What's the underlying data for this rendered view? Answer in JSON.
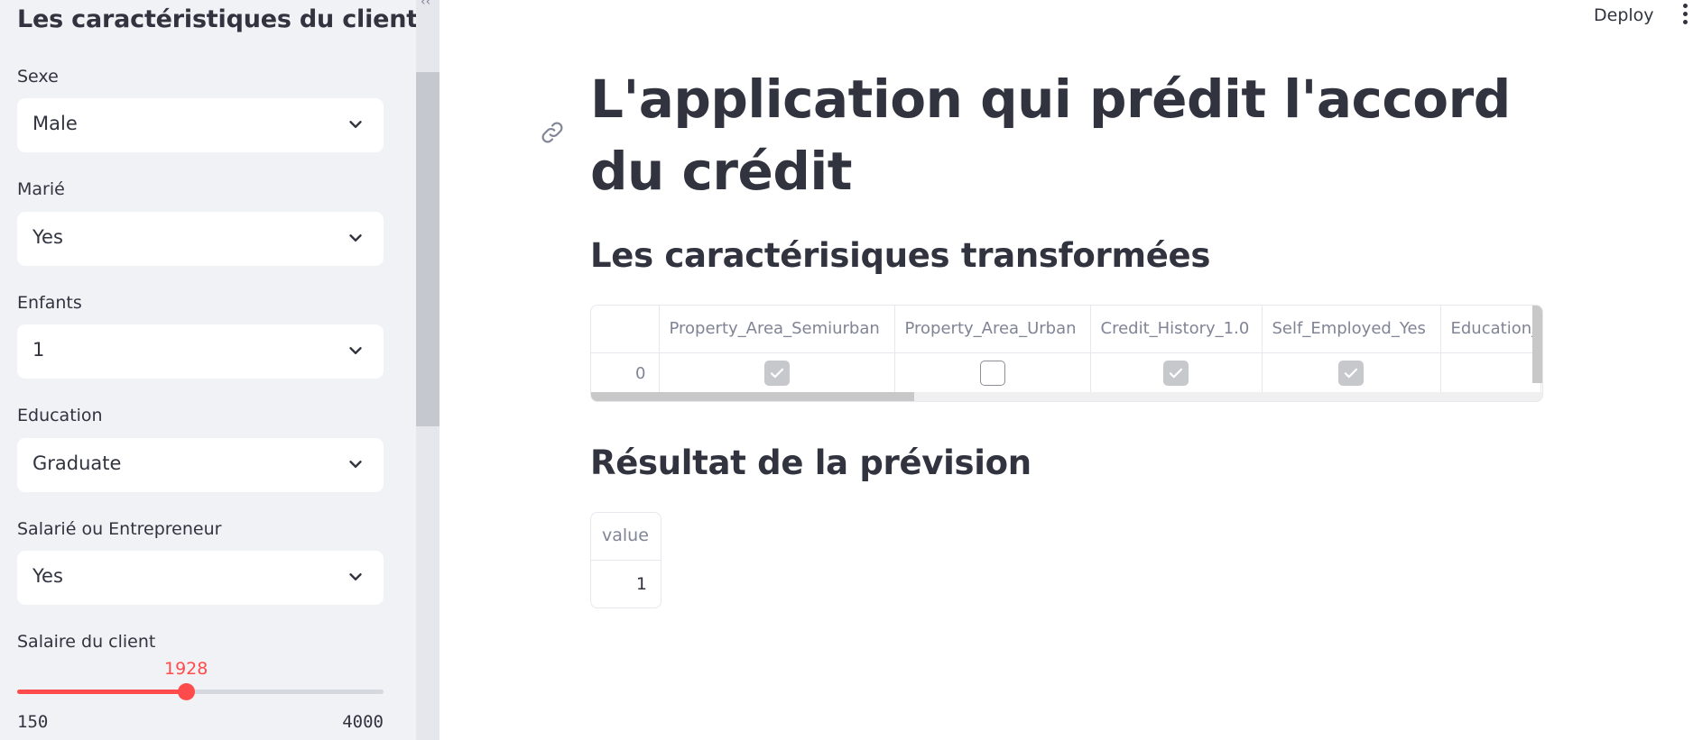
{
  "sidebar": {
    "title": "Les caractéristiques du client",
    "fields": [
      {
        "label": "Sexe",
        "value": "Male"
      },
      {
        "label": "Marié",
        "value": "Yes"
      },
      {
        "label": "Enfants",
        "value": "1"
      },
      {
        "label": "Education",
        "value": "Graduate"
      },
      {
        "label": "Salarié ou Entrepreneur",
        "value": "Yes"
      }
    ],
    "slider": {
      "label": "Salaire du client",
      "value": "1928",
      "min": "150",
      "max": "4000",
      "fraction": 0.4618
    }
  },
  "header": {
    "deploy_label": "Deploy"
  },
  "main": {
    "title": "L'application qui prédit l'accord du crédit",
    "transformed_heading": "Les caractérisiques transformées",
    "dataframe": {
      "columns": [
        "Property_Area_Semiurban",
        "Property_Area_Urban",
        "Credit_History_1.0",
        "Self_Employed_Yes",
        "Education_"
      ],
      "rows": [
        {
          "index": "0",
          "values": [
            true,
            false,
            true,
            true,
            null
          ]
        }
      ]
    },
    "result_heading": "Résultat de la prévision",
    "result": {
      "column": "value",
      "value": "1"
    }
  },
  "colors": {
    "accent": "#ff4b4b",
    "sidebar_bg": "#f0f2f6",
    "text": "#31333f",
    "muted": "#808495"
  }
}
